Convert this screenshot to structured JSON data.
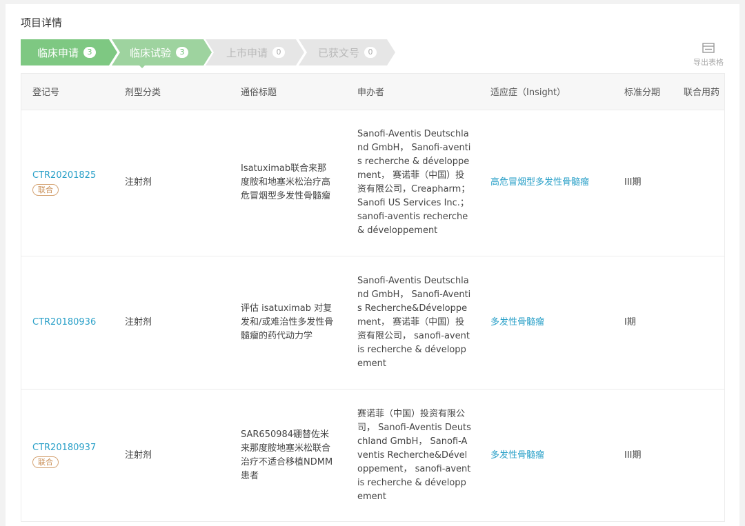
{
  "page": {
    "title": "项目详情"
  },
  "steps": [
    {
      "label": "临床申请",
      "count": "3",
      "state": "active"
    },
    {
      "label": "临床试验",
      "count": "3",
      "state": "active"
    },
    {
      "label": "上市申请",
      "count": "0",
      "state": "inactive"
    },
    {
      "label": "已获文号",
      "count": "0",
      "state": "inactive"
    }
  ],
  "export": {
    "label": "导出表格",
    "icon": "table-export-icon"
  },
  "table": {
    "columns": [
      "登记号",
      "剂型分类",
      "通俗标题",
      "申办者",
      "适应症（Insight）",
      "标准分期",
      "联合用药"
    ],
    "rows": [
      {
        "id": "CTR20201825",
        "tag": "联合",
        "form": "注射剂",
        "title": "Isatuximab联合来那度胺和地塞米松治疗高危冒烟型多发性骨髓瘤",
        "sponsor": "Sanofi-Aventis Deutschland GmbH， Sanofi-aventis recherche & développement， 赛诺菲（中国）投资有限公司，Creapharm；Sanofi US Services Inc.；sanofi-aventis recherche & développement",
        "indication": "高危冒烟型多发性骨髓瘤",
        "phase": "III期",
        "combo": ""
      },
      {
        "id": "CTR20180936",
        "tag": "",
        "form": "注射剂",
        "title": "评估 isatuximab 对复发和/或难治性多发性骨髓瘤的药代动力学",
        "sponsor": "Sanofi-Aventis Deutschland GmbH， Sanofi-Aventis Recherche&Développement， 赛诺菲（中国）投资有限公司， sanofi-aventis recherche & développement",
        "indication": "多发性骨髓瘤",
        "phase": "I期",
        "combo": ""
      },
      {
        "id": "CTR20180937",
        "tag": "联合",
        "form": "注射剂",
        "title": "SAR650984硼替佐米来那度胺地塞米松联合治疗不适合移植NDMM患者",
        "sponsor": "赛诺菲（中国）投资有限公司， Sanofi-Aventis Deutschland GmbH， Sanofi-Aventis Recherche&Développement， sanofi-aventis recherche & développement",
        "indication": "多发性骨髓瘤",
        "phase": "III期",
        "combo": ""
      }
    ]
  },
  "colors": {
    "step_active_1": "#7ec882",
    "step_active_2": "#9ed39f",
    "step_inactive": "#e6e6e6",
    "link": "#2aa0c8",
    "tag": "#c88d54"
  }
}
